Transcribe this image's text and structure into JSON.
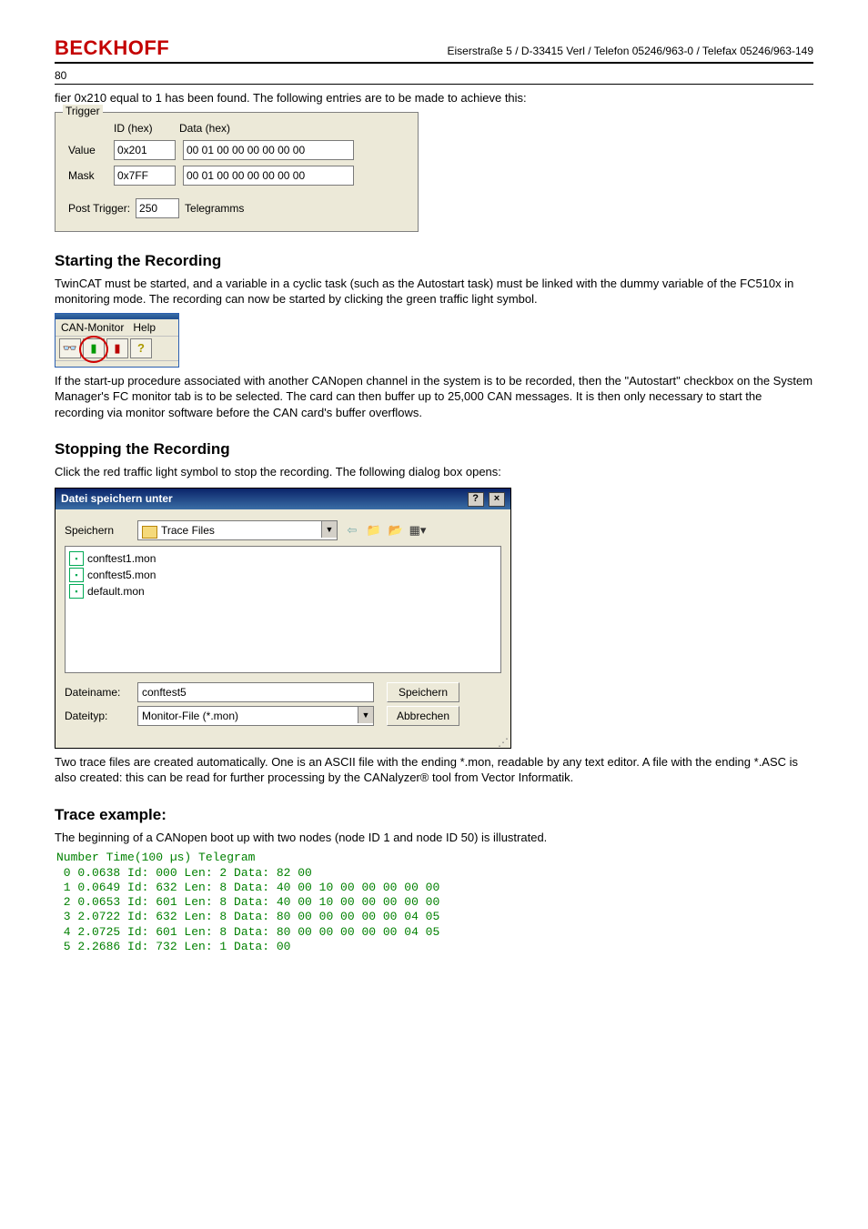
{
  "header": {
    "brand": "BECKHOFF",
    "address": "Eiserstraße 5 / D-33415 Verl / Telefon 05246/963-0 / Telefax 05246/963-149",
    "page_number": "80"
  },
  "intro_line": "fier 0x210 equal to 1 has been found. The following entries are to be made to achieve this:",
  "trigger": {
    "legend": "Trigger",
    "id_header": "ID (hex)",
    "data_header": "Data (hex)",
    "value_label": "Value",
    "value_id": "0x201",
    "value_data": "00 01 00 00 00 00 00 00",
    "mask_label": "Mask",
    "mask_id": "0x7FF",
    "mask_data": "00 01 00 00 00 00 00 00",
    "post_trigger_label": "Post Trigger:",
    "post_trigger_value": "250",
    "post_trigger_unit": "Telegramms"
  },
  "section_start": {
    "heading": "Starting the Recording",
    "para1": "TwinCAT must be started, and a variable in a cyclic task (such as the Autostart task) must be linked with the dummy variable of the FC510x in monitoring mode. The recording can now be started by clicking the green traffic light symbol.",
    "toolbar": {
      "menu1": "CAN-Monitor",
      "menu2": "Help",
      "glasses": "👓",
      "green_light": "▮",
      "red_light": "▮",
      "help": "?"
    },
    "para2": "If the start-up procedure associated with another CANopen channel in the system is to be recorded, then the \"Autostart\" checkbox on the System Manager's FC monitor tab is to be selected. The card can then buffer up to 25,000 CAN messages. It is then only necessary to start the recording via monitor software before the CAN card's buffer overflows."
  },
  "section_stop": {
    "heading": "Stopping the Recording",
    "para1": "Click the red traffic light symbol to stop the recording. The following dialog box opens:",
    "dialog": {
      "title": "Datei speichern unter",
      "help_btn": "?",
      "close_btn": "×",
      "savein_label": "Speichern",
      "folder": "Trace Files",
      "files": [
        "conftest1.mon",
        "conftest5.mon",
        "default.mon"
      ],
      "filename_label": "Dateiname:",
      "filename_value": "conftest5",
      "filetype_label": "Dateityp:",
      "filetype_value": "Monitor-File (*.mon)",
      "save_btn": "Speichern",
      "cancel_btn": "Abbrechen"
    },
    "para2": "Two trace files are created automatically. One is an ASCII file with the ending *.mon, readable by any text editor. A file with the ending *.ASC is also created: this can be read for further processing by the CANalyzer® tool from Vector Informatik."
  },
  "section_trace": {
    "heading": "Trace example:",
    "para1": "The beginning of a CANopen boot up with two nodes (node ID 1 and node ID 50) is illustrated.",
    "trace_text": "Number Time(100 µs) Telegram\n 0 0.0638 Id: 000 Len: 2 Data: 82 00\n 1 0.0649 Id: 632 Len: 8 Data: 40 00 10 00 00 00 00 00\n 2 0.0653 Id: 601 Len: 8 Data: 40 00 10 00 00 00 00 00\n 3 2.0722 Id: 632 Len: 8 Data: 80 00 00 00 00 00 04 05\n 4 2.0725 Id: 601 Len: 8 Data: 80 00 00 00 00 00 04 05\n 5 2.2686 Id: 732 Len: 1 Data: 00"
  }
}
